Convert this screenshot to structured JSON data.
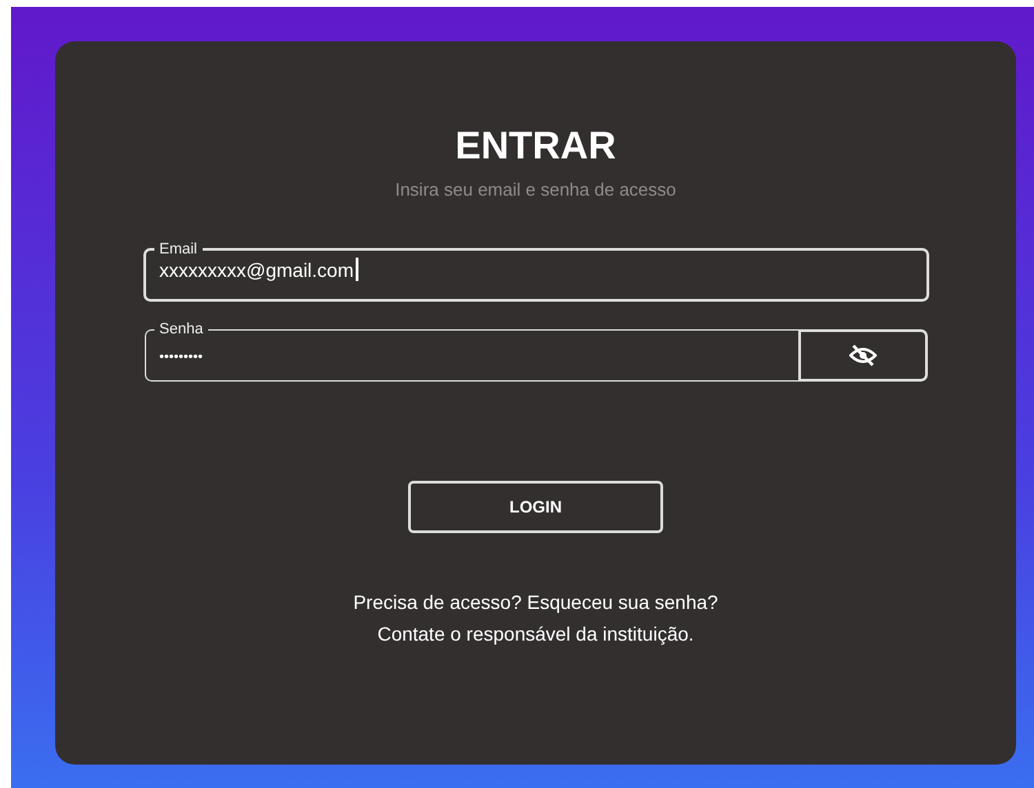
{
  "title": "ENTRAR",
  "subtitle": "Insira seu email e senha de acesso",
  "email_field": {
    "label": "Email",
    "value": "xxxxxxxxx@gmail.com",
    "focused": true
  },
  "password_field": {
    "label": "Senha",
    "value": "•••••••••",
    "visible": false
  },
  "login_button": "LOGIN",
  "help_lines": [
    "Precisa de acesso? Esqueceu sua senha?",
    "Contate o responsável da instituição."
  ]
}
